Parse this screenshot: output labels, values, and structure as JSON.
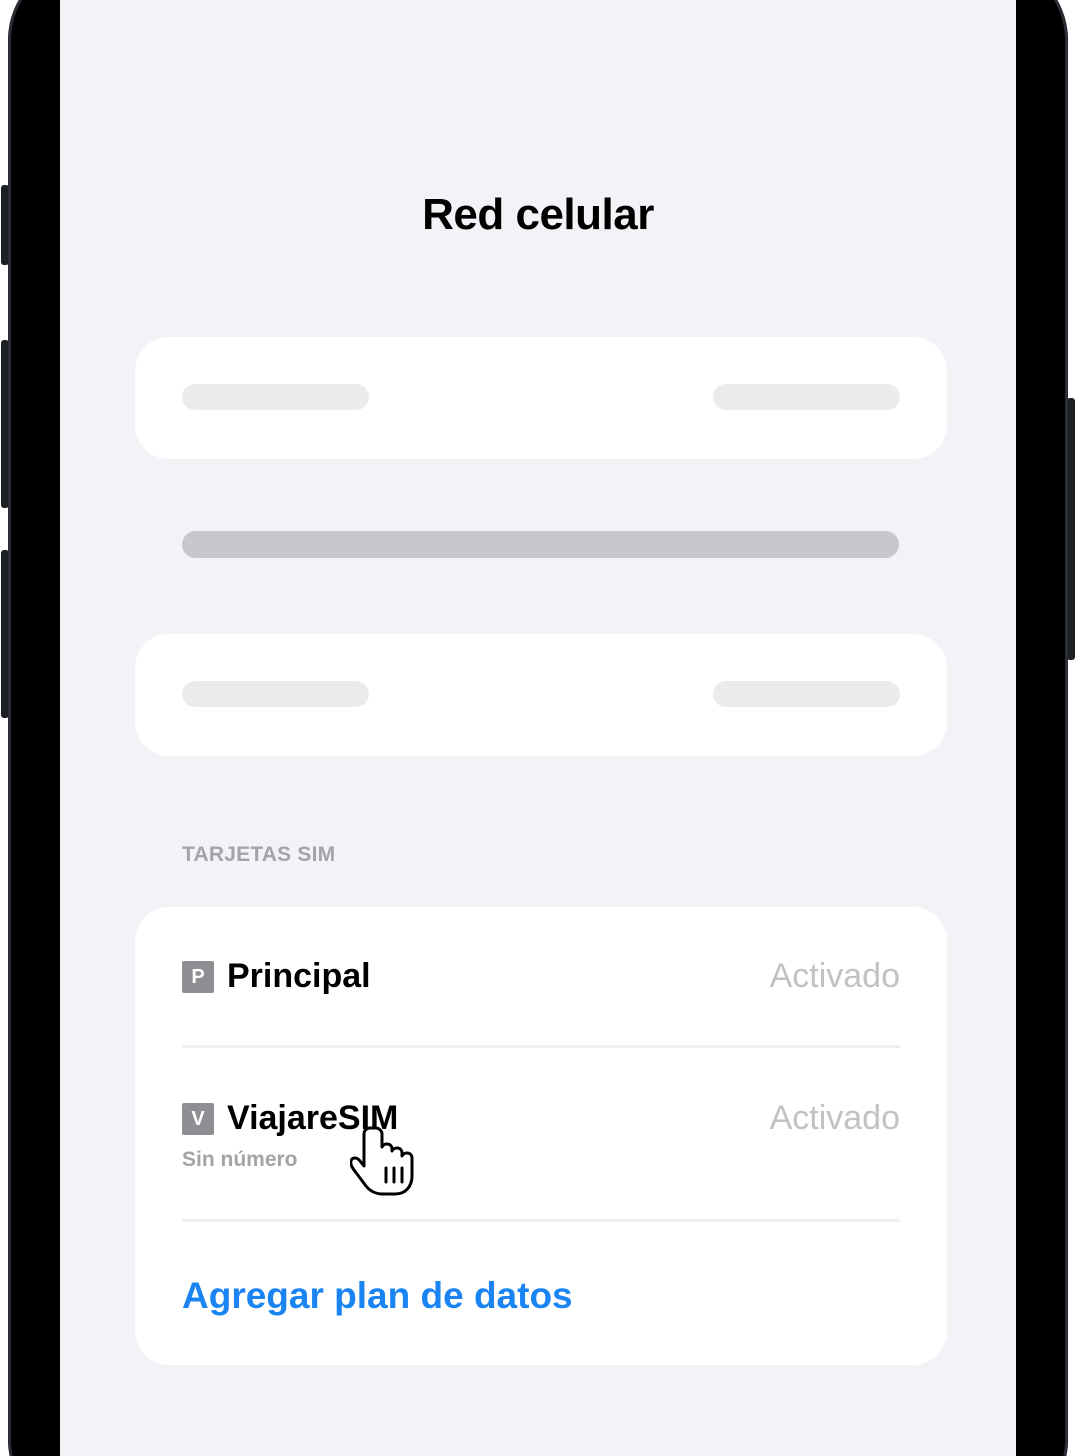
{
  "screen": {
    "title": "Red celular"
  },
  "sim_section": {
    "header": "TARJETAS SIM",
    "sims": [
      {
        "badge": "P",
        "name": "Principal",
        "status": "Activado",
        "subtitle": ""
      },
      {
        "badge": "V",
        "name": "ViajareSIM",
        "status": "Activado",
        "subtitle": "Sin número"
      }
    ],
    "add_plan_label": "Agregar plan de datos"
  },
  "colors": {
    "background": "#f2f3f7",
    "card": "#ffffff",
    "accent": "#1a84f2",
    "secondary_text": "#a3a4a8",
    "status_text": "#c2c2c6",
    "badge": "#8e8e93"
  },
  "icons": {
    "cursor": "hand-pointer-icon"
  }
}
